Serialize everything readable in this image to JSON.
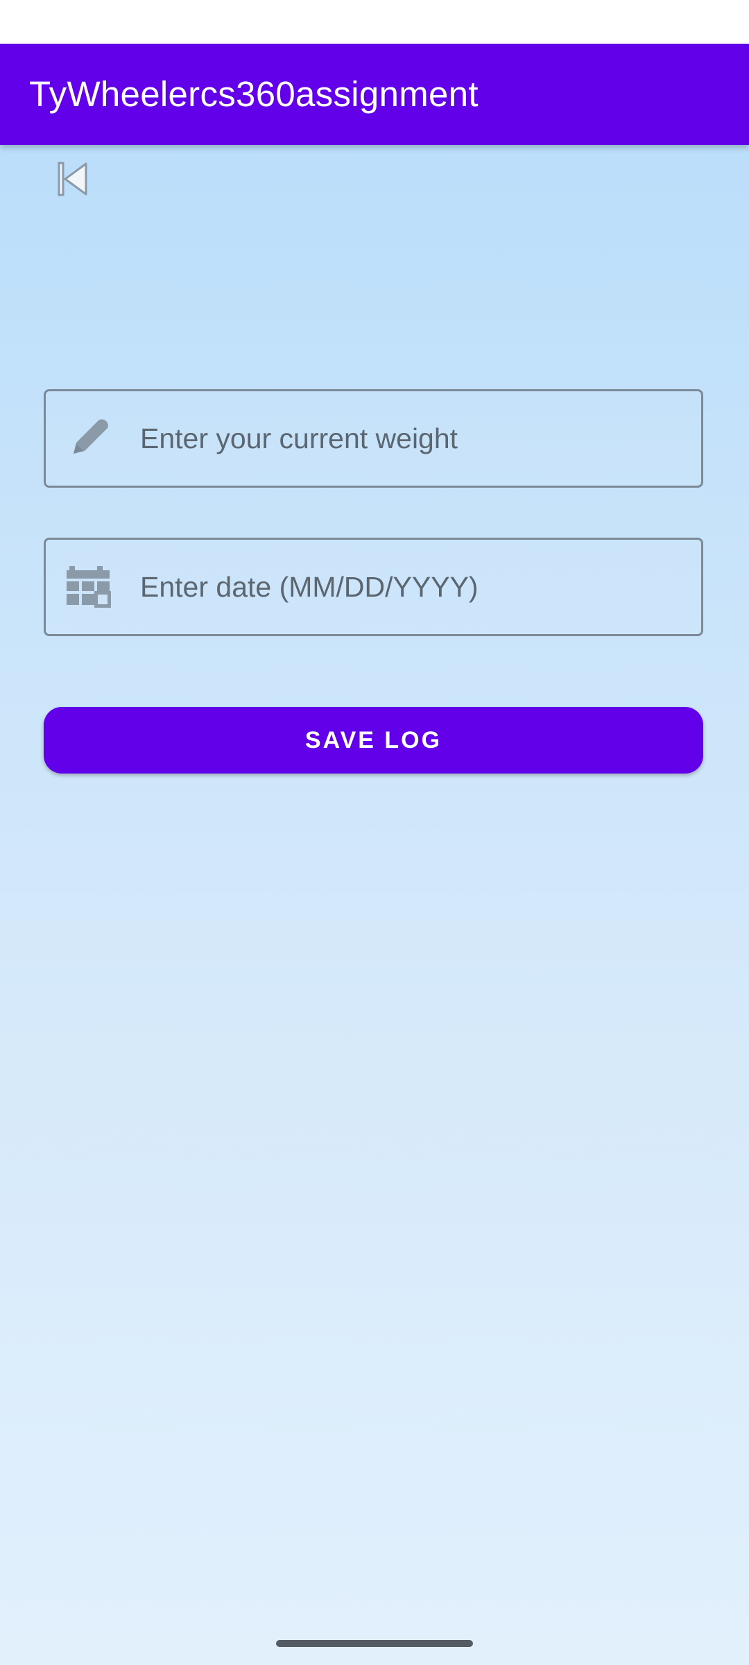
{
  "app_bar": {
    "title": "TyWheelercs360assignment",
    "color": "#6200ea"
  },
  "back_button": {
    "icon": "skip-previous-icon"
  },
  "weight_field": {
    "icon": "pencil-icon",
    "value": "",
    "placeholder": "Enter your current weight"
  },
  "date_field": {
    "icon": "calendar-icon",
    "value": "",
    "placeholder": "Enter date (MM/DD/YYYY)"
  },
  "save_button": {
    "label": "SAVE LOG",
    "color": "#6200ea"
  },
  "colors": {
    "background_top": "#bbdefa",
    "background_bottom": "#e2f0fc",
    "field_border": "#7b8a96",
    "icon_gray": "#8a9aa8"
  }
}
